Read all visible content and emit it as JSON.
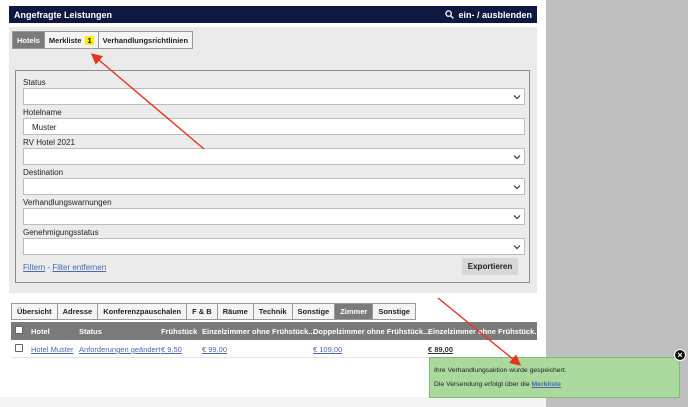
{
  "header": {
    "title": "Angefragte Leistungen",
    "toggle_label": "ein- / ausblenden",
    "toggle_icon": "search-icon"
  },
  "top_tabs": [
    {
      "label": "Hotels",
      "active": true
    },
    {
      "label": "Merkliste",
      "badge": "1",
      "active": false
    },
    {
      "label": "Verhandlungsrichtlinien",
      "active": false
    }
  ],
  "filters": {
    "status_label": "Status",
    "status_value": "",
    "hotelname_label": "Hotelname",
    "hotelname_value": "Muster",
    "rv_label": "RV Hotel 2021",
    "rv_value": "",
    "destination_label": "Destination",
    "destination_value": "",
    "warnings_label": "Verhandlungswarnungen",
    "warnings_value": "",
    "approval_label": "Genehmigungsstatus",
    "approval_value": "",
    "filter_link": "Filtern",
    "separator": " - ",
    "clear_link": "Filter entfernen",
    "export_button": "Exportieren"
  },
  "sub_tabs": [
    {
      "label": "Übersicht",
      "active": false
    },
    {
      "label": "Adresse",
      "active": false
    },
    {
      "label": "Konferenzpauschalen",
      "active": false
    },
    {
      "label": "F & B",
      "active": false
    },
    {
      "label": "Räume",
      "active": false
    },
    {
      "label": "Technik",
      "active": false
    },
    {
      "label": "Sonstige",
      "active": false
    },
    {
      "label": "Zimmer",
      "active": true
    },
    {
      "label": "Sonstige",
      "active": false
    }
  ],
  "table": {
    "headers": {
      "hotel": "Hotel",
      "status": "Status",
      "breakfast": "Frühstück",
      "single": "Einzelzimmer ohne Frühstück...",
      "double": "Doppelzimmer ohne Frühstück...",
      "single2": "Einzelzimmer ohne Frühstück..."
    },
    "rows": [
      {
        "hotel": "Hotel Muster",
        "status": "Anforderungen geändert",
        "breakfast": "€ 9,50",
        "single": "€ 99,00",
        "double": "€ 109,00",
        "single2": "€ 89,00"
      }
    ]
  },
  "toast": {
    "line1": "Ihre Verhandlungsaktion wurde gespeichert.",
    "line2_prefix": "Die Versendung erfolgt über die ",
    "line2_link": "Merkliste",
    "close_icon": "close-icon"
  },
  "colors": {
    "header_bg": "#0e1840",
    "active_tab": "#7b7b7b",
    "badge": "#ffef00",
    "link": "#4a67b3",
    "toast_bg": "#a9d99c",
    "annotation_arrow": "#e8321e"
  }
}
